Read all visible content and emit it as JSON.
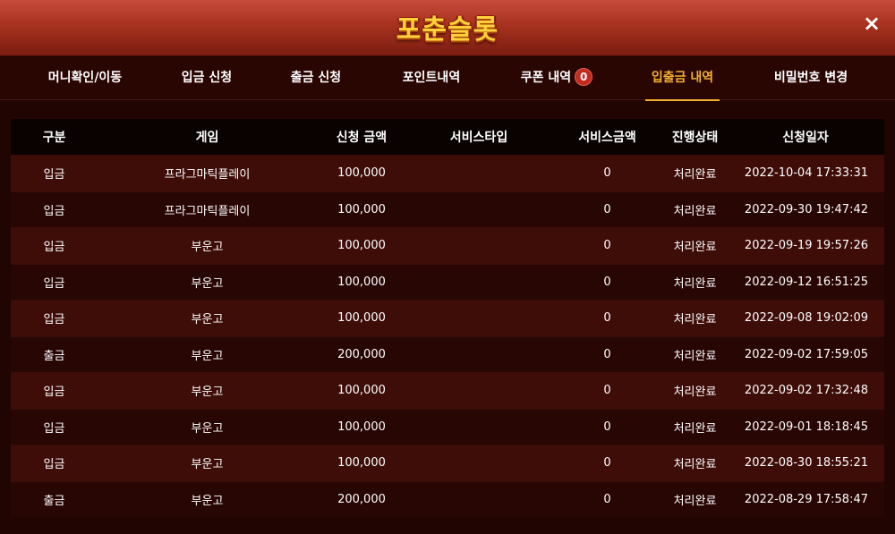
{
  "header": {
    "logo_text": "포춘슬롯",
    "close_label": "×"
  },
  "tabs": [
    {
      "label": "머니확인/이동",
      "active": false
    },
    {
      "label": "입금 신청",
      "active": false
    },
    {
      "label": "출금 신청",
      "active": false
    },
    {
      "label": "포인트내역",
      "active": false
    },
    {
      "label": "쿠폰 내역",
      "badge": "0",
      "active": false
    },
    {
      "label": "입출금 내역",
      "active": true
    },
    {
      "label": "비밀번호 변경",
      "active": false
    }
  ],
  "table": {
    "columns": [
      "구분",
      "게임",
      "신청 금액",
      "서비스타입",
      "서비스금액",
      "진행상태",
      "신청일자"
    ],
    "rows": [
      [
        "입금",
        "프라그마틱플레이",
        "100,000",
        "",
        "0",
        "처리완료",
        "2022-10-04 17:33:31"
      ],
      [
        "입금",
        "프라그마틱플레이",
        "100,000",
        "",
        "0",
        "처리완료",
        "2022-09-30 19:47:42"
      ],
      [
        "입금",
        "부운고",
        "100,000",
        "",
        "0",
        "처리완료",
        "2022-09-19 19:57:26"
      ],
      [
        "입금",
        "부운고",
        "100,000",
        "",
        "0",
        "처리완료",
        "2022-09-12 16:51:25"
      ],
      [
        "입금",
        "부운고",
        "100,000",
        "",
        "0",
        "처리완료",
        "2022-09-08 19:02:09"
      ],
      [
        "출금",
        "부운고",
        "200,000",
        "",
        "0",
        "처리완료",
        "2022-09-02 17:59:05"
      ],
      [
        "입금",
        "부운고",
        "100,000",
        "",
        "0",
        "처리완료",
        "2022-09-02 17:32:48"
      ],
      [
        "입금",
        "부운고",
        "100,000",
        "",
        "0",
        "처리완료",
        "2022-09-01 18:18:45"
      ],
      [
        "입금",
        "부운고",
        "100,000",
        "",
        "0",
        "처리완료",
        "2022-08-30 18:55:21"
      ],
      [
        "출금",
        "부운고",
        "200,000",
        "",
        "0",
        "처리완료",
        "2022-08-29 17:58:47"
      ]
    ]
  },
  "colors": {
    "accent": "#f0b030",
    "header": "#a8321f",
    "badge": "#c42b1f"
  }
}
